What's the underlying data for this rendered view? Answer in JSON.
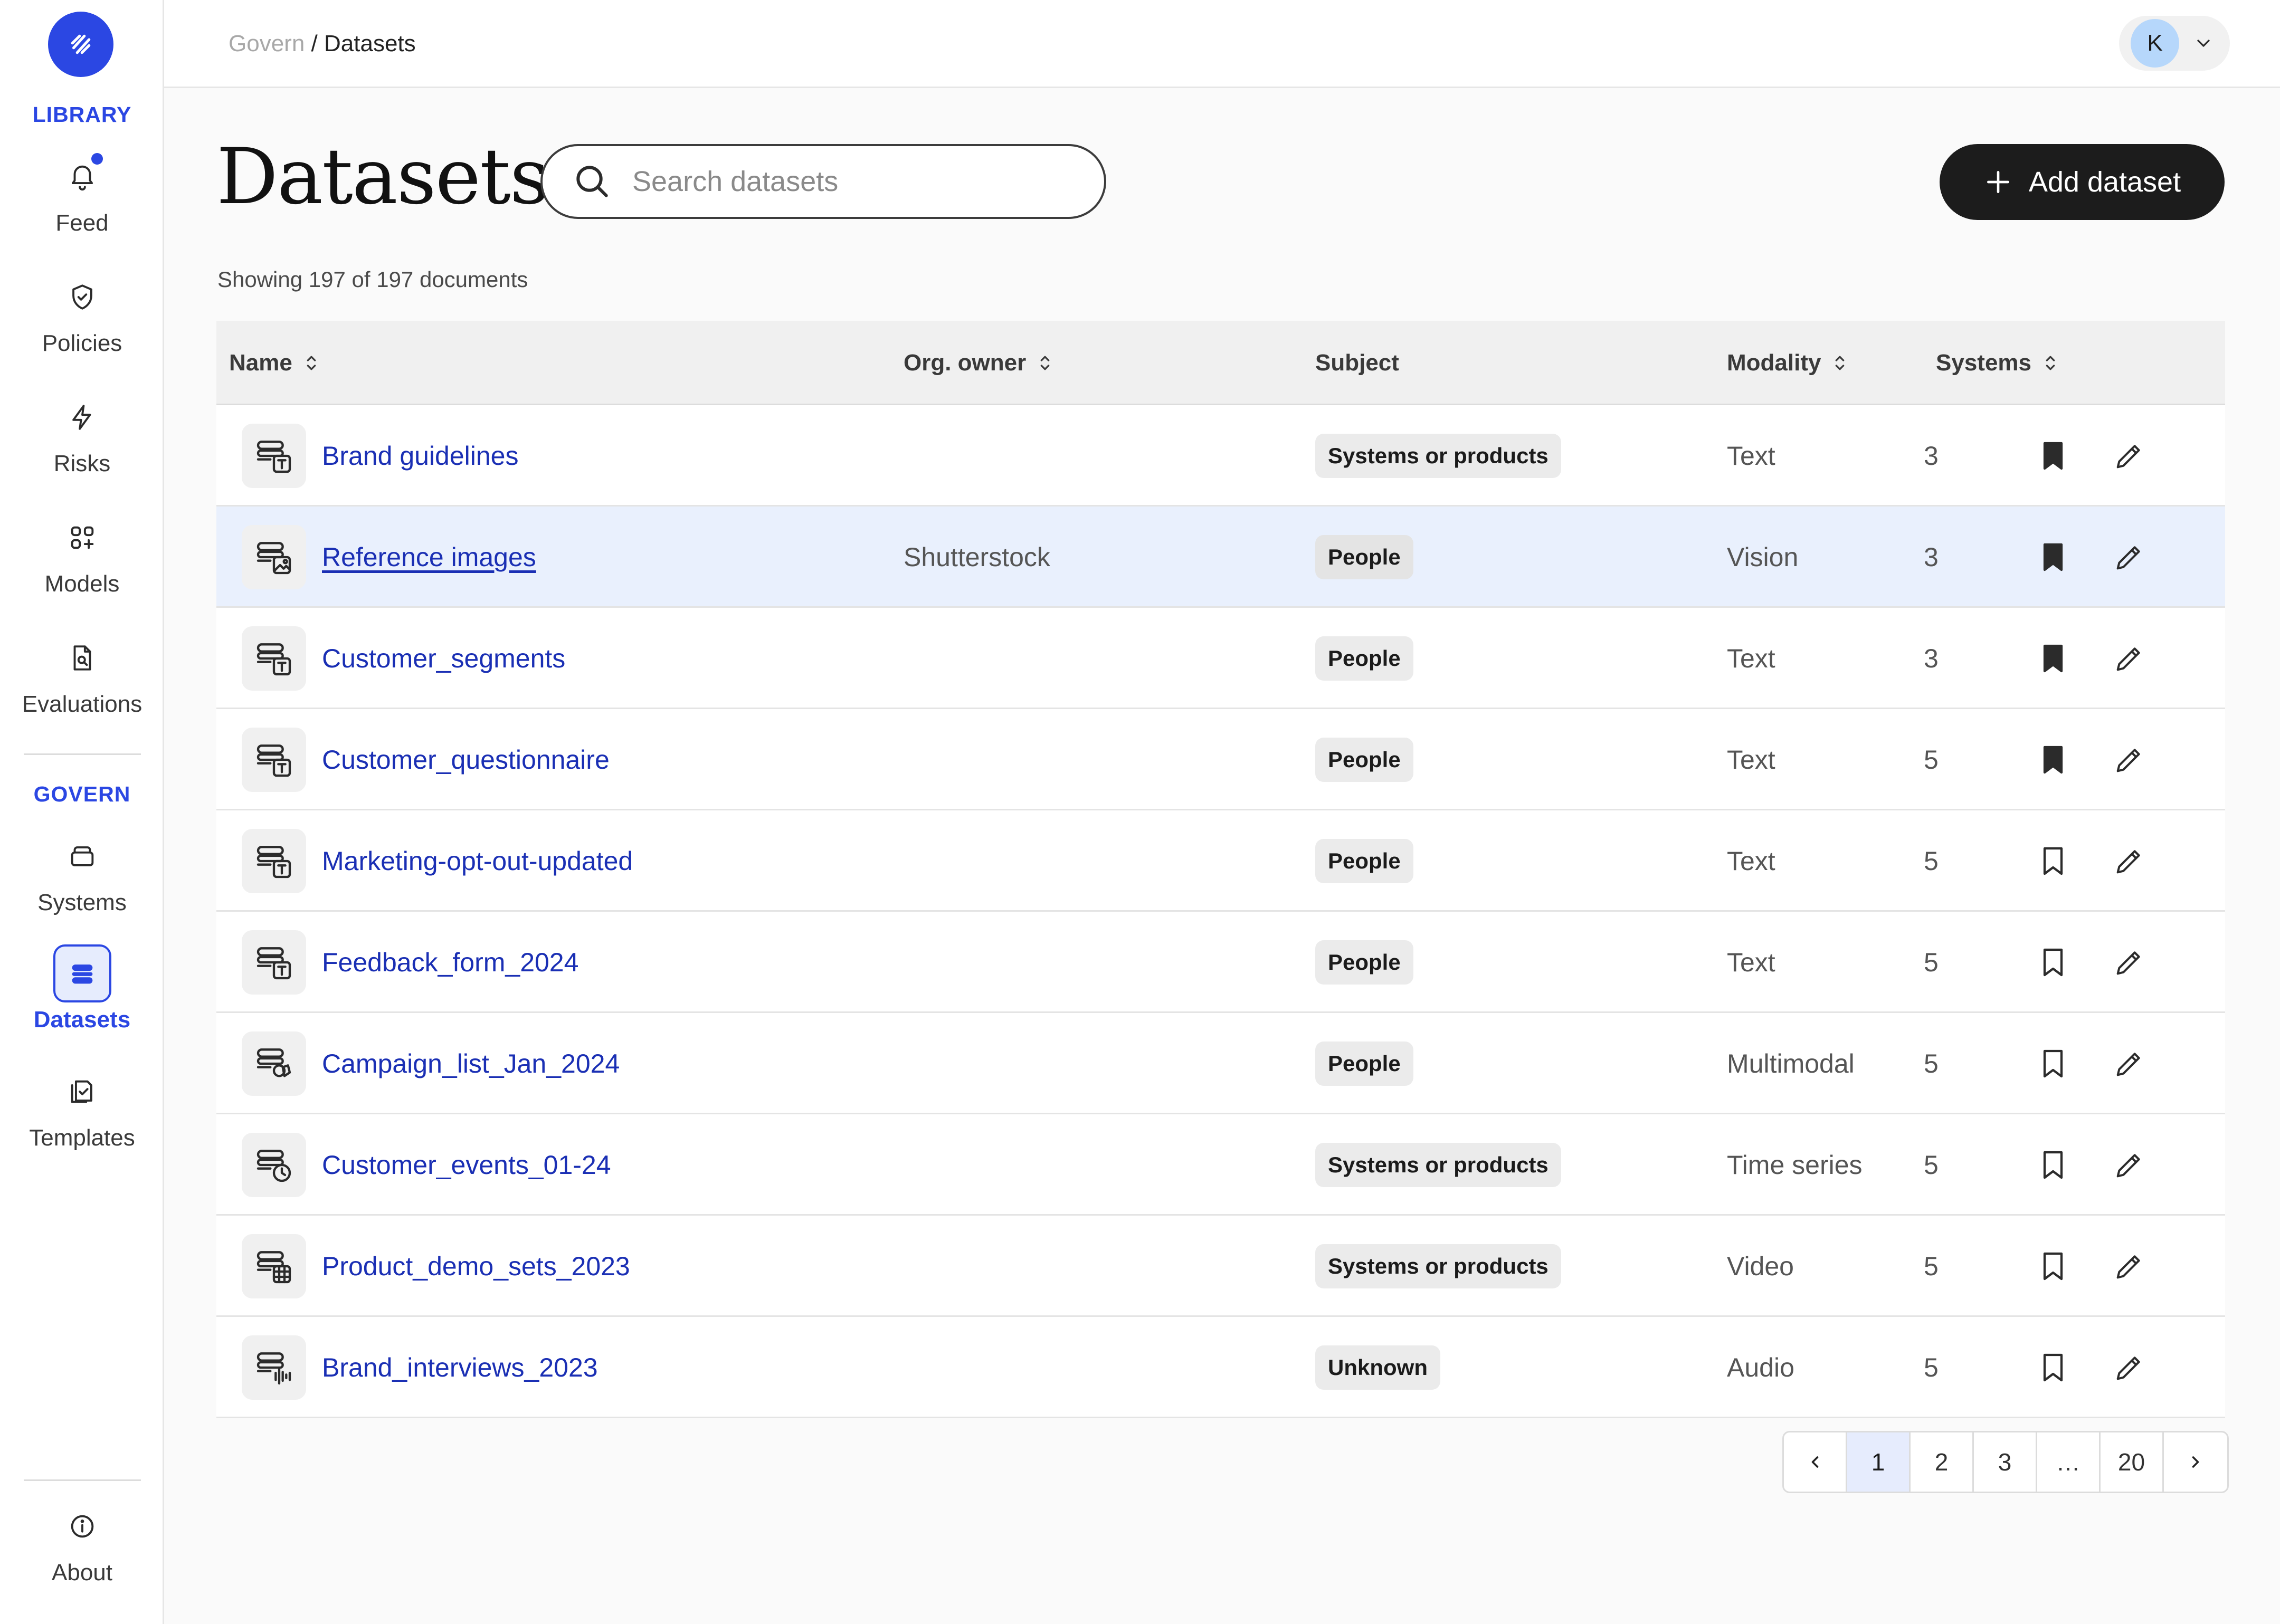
{
  "sidebar": {
    "library_title": "LIBRARY",
    "govern_title": "GOVERN",
    "items": [
      {
        "label": "Feed",
        "icon": "bell-icon"
      },
      {
        "label": "Policies",
        "icon": "shield-icon"
      },
      {
        "label": "Risks",
        "icon": "lightning-icon"
      },
      {
        "label": "Models",
        "icon": "models-grid-icon"
      },
      {
        "label": "Evaluations",
        "icon": "document-search-icon"
      },
      {
        "label": "Systems",
        "icon": "systems-stack-icon"
      },
      {
        "label": "Datasets",
        "icon": "database-icon",
        "active": true
      },
      {
        "label": "Templates",
        "icon": "templates-icon"
      },
      {
        "label": "About",
        "icon": "info-icon"
      }
    ]
  },
  "topbar": {
    "breadcrumb_parent": "Govern",
    "breadcrumb_separator": "/",
    "breadcrumb_current": "Datasets",
    "user_initial": "K"
  },
  "header": {
    "title": "Datasets",
    "search_placeholder": "Search datasets",
    "add_button_label": "Add dataset",
    "count_text": "Showing 197 of 197 documents"
  },
  "table": {
    "columns": {
      "name": "Name",
      "org_owner": "Org. owner",
      "subject": "Subject",
      "modality": "Modality",
      "systems": "Systems"
    },
    "rows": [
      {
        "name": "Brand guidelines",
        "owner": "",
        "subject": "Systems or products",
        "modality": "Text",
        "systems": "3",
        "bookmarked": true,
        "type_icon": "text-dataset-icon"
      },
      {
        "name": "Reference images",
        "owner": "Shutterstock",
        "subject": "People",
        "modality": "Vision",
        "systems": "3",
        "bookmarked": true,
        "type_icon": "image-dataset-icon"
      },
      {
        "name": "Customer_segments",
        "owner": "",
        "subject": "People",
        "modality": "Text",
        "systems": "3",
        "bookmarked": true,
        "type_icon": "text-dataset-icon"
      },
      {
        "name": "Customer_questionnaire",
        "owner": "",
        "subject": "People",
        "modality": "Text",
        "systems": "5",
        "bookmarked": true,
        "type_icon": "text-dataset-icon"
      },
      {
        "name": "Marketing-opt-out-updated",
        "owner": "",
        "subject": "People",
        "modality": "Text",
        "systems": "5",
        "bookmarked": false,
        "type_icon": "text-dataset-icon"
      },
      {
        "name": "Feedback_form_2024",
        "owner": "",
        "subject": "People",
        "modality": "Text",
        "systems": "5",
        "bookmarked": false,
        "type_icon": "text-dataset-icon"
      },
      {
        "name": "Campaign_list_Jan_2024",
        "owner": "",
        "subject": "People",
        "modality": "Multimodal",
        "systems": "5",
        "bookmarked": false,
        "type_icon": "multimodal-dataset-icon"
      },
      {
        "name": "Customer_events_01-24",
        "owner": "",
        "subject": "Systems or products",
        "modality": "Time series",
        "systems": "5",
        "bookmarked": false,
        "type_icon": "timeseries-dataset-icon"
      },
      {
        "name": "Product_demo_sets_2023",
        "owner": "",
        "subject": "Systems or products",
        "modality": "Video",
        "systems": "5",
        "bookmarked": false,
        "type_icon": "video-dataset-icon"
      },
      {
        "name": "Brand_interviews_2023",
        "owner": "",
        "subject": "Unknown",
        "modality": "Audio",
        "systems": "5",
        "bookmarked": false,
        "type_icon": "audio-dataset-icon"
      }
    ]
  },
  "pagination": {
    "pages": [
      "1",
      "2",
      "3",
      "…",
      "20"
    ],
    "current": "1"
  },
  "colors": {
    "accent": "#2b47e3",
    "link": "#1a2fb4",
    "highlight_row": "#e9f0fd",
    "primary_button": "#1c1c1c"
  }
}
